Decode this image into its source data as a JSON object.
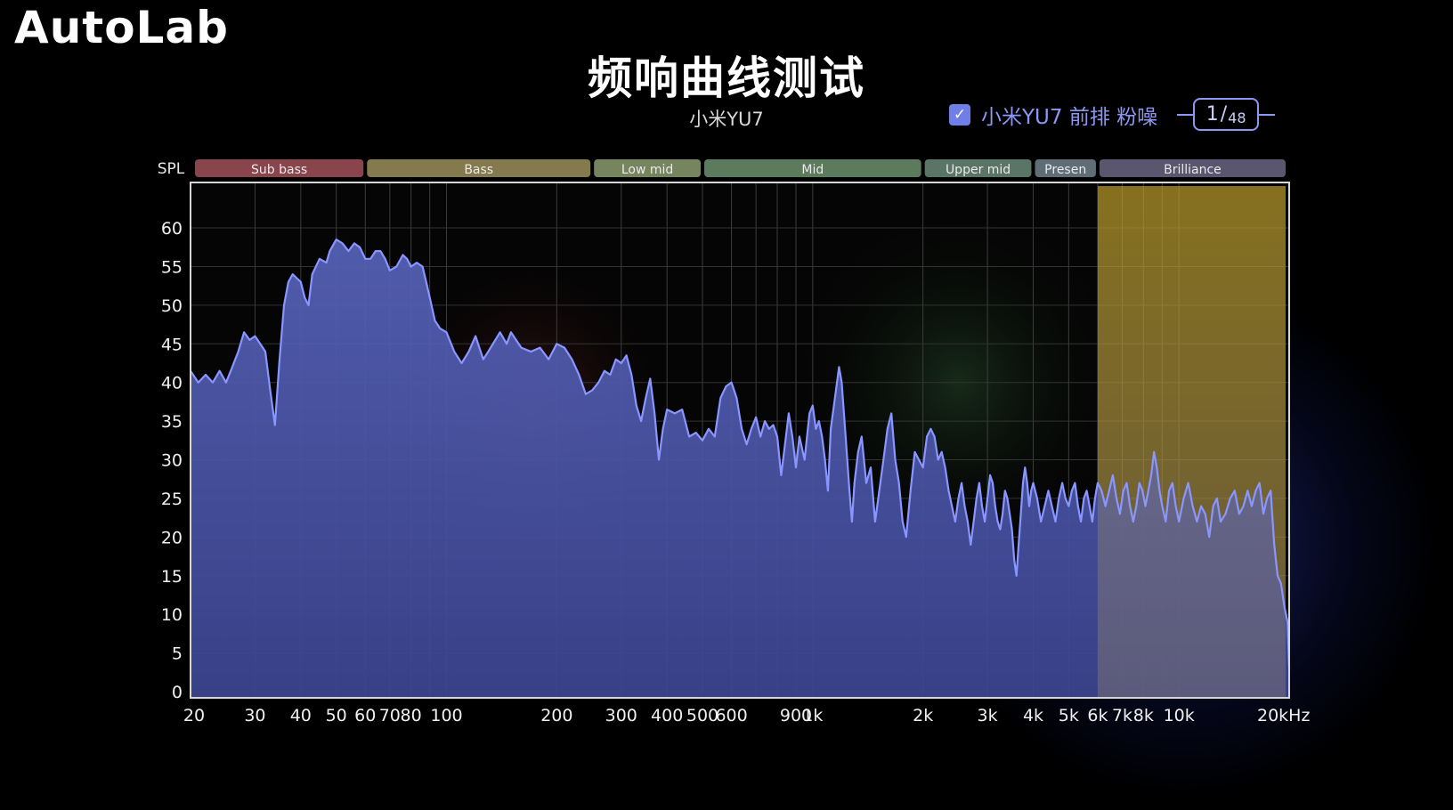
{
  "brand": {
    "logo": "AutoLab"
  },
  "header": {
    "title": "频响曲线测试",
    "subtitle": "小米YU7"
  },
  "legend": {
    "checked": true,
    "label": "小米YU7 前排 粉噪",
    "page_current": "1",
    "page_separator": "/",
    "page_total": "48"
  },
  "colors": {
    "background": "#000000",
    "series_line": "#8a96ff",
    "series_fill": "#4a57a8",
    "accent": "#8b97f2",
    "highlight_band": "#b89a1e"
  },
  "chart_data": {
    "type": "area",
    "title": "频响曲线测试",
    "ylabel": "SPL",
    "xlabel": "",
    "x_scale": "log",
    "x_unit": "Hz",
    "xlim": [
      20,
      20000
    ],
    "ylim": [
      0,
      63
    ],
    "grid": true,
    "y_ticks": [
      "0",
      "5",
      "10",
      "15",
      "20",
      "25",
      "30",
      "35",
      "40",
      "45",
      "50",
      "55",
      "60"
    ],
    "x_ticks": [
      {
        "v": 20,
        "label": "20"
      },
      {
        "v": 30,
        "label": "30"
      },
      {
        "v": 40,
        "label": "40"
      },
      {
        "v": 50,
        "label": "50"
      },
      {
        "v": 60,
        "label": "60"
      },
      {
        "v": 70,
        "label": "70"
      },
      {
        "v": 80,
        "label": "80"
      },
      {
        "v": 100,
        "label": "100"
      },
      {
        "v": 200,
        "label": "200"
      },
      {
        "v": 300,
        "label": "300"
      },
      {
        "v": 400,
        "label": "400"
      },
      {
        "v": 500,
        "label": "500"
      },
      {
        "v": 600,
        "label": "600"
      },
      {
        "v": 900,
        "label": "900"
      },
      {
        "v": 1000,
        "label": "1k"
      },
      {
        "v": 2000,
        "label": "2k"
      },
      {
        "v": 3000,
        "label": "3k"
      },
      {
        "v": 4000,
        "label": "4k"
      },
      {
        "v": 5000,
        "label": "5k"
      },
      {
        "v": 6000,
        "label": "6k"
      },
      {
        "v": 7000,
        "label": "7k"
      },
      {
        "v": 8000,
        "label": "8k"
      },
      {
        "v": 10000,
        "label": "10k"
      },
      {
        "v": 20000,
        "label": "20kHz"
      }
    ],
    "bands": [
      {
        "name": "Sub bass",
        "from": 20,
        "to": 60,
        "color": "#8a454c"
      },
      {
        "name": "Bass",
        "from": 60,
        "to": 250,
        "color": "#857a4e"
      },
      {
        "name": "Low mid",
        "from": 250,
        "to": 500,
        "color": "#77855f"
      },
      {
        "name": "Mid",
        "from": 500,
        "to": 2000,
        "color": "#5c7a5c"
      },
      {
        "name": "Upper mid",
        "from": 2000,
        "to": 4000,
        "color": "#5a7565"
      },
      {
        "name": "Presen",
        "from": 4000,
        "to": 6000,
        "color": "#5f6e76"
      },
      {
        "name": "Brilliance",
        "from": 6000,
        "to": 20000,
        "color": "#5a5670"
      }
    ],
    "highlight": {
      "from": 6000,
      "to": 20000
    },
    "series": [
      {
        "name": "小米YU7 前排 粉噪",
        "points": [
          [
            20,
            41.5
          ],
          [
            21,
            40
          ],
          [
            22,
            41
          ],
          [
            23,
            40
          ],
          [
            24,
            41.5
          ],
          [
            25,
            40
          ],
          [
            26,
            42
          ],
          [
            27,
            44
          ],
          [
            28,
            46.5
          ],
          [
            29,
            45.5
          ],
          [
            30,
            46
          ],
          [
            31,
            45
          ],
          [
            32,
            44
          ],
          [
            33,
            39
          ],
          [
            34,
            34.5
          ],
          [
            35,
            43
          ],
          [
            36,
            50
          ],
          [
            37,
            53
          ],
          [
            38,
            54
          ],
          [
            39,
            53.5
          ],
          [
            40,
            53
          ],
          [
            41,
            51
          ],
          [
            42,
            50
          ],
          [
            43,
            54
          ],
          [
            44,
            55
          ],
          [
            45,
            56
          ],
          [
            47,
            55.5
          ],
          [
            48,
            57
          ],
          [
            50,
            58.5
          ],
          [
            52,
            58
          ],
          [
            54,
            57
          ],
          [
            56,
            58
          ],
          [
            58,
            57.5
          ],
          [
            60,
            56
          ],
          [
            62,
            56
          ],
          [
            64,
            57
          ],
          [
            66,
            57
          ],
          [
            68,
            56
          ],
          [
            70,
            54.5
          ],
          [
            73,
            55
          ],
          [
            76,
            56.5
          ],
          [
            78,
            56
          ],
          [
            80,
            55
          ],
          [
            83,
            55.5
          ],
          [
            86,
            55
          ],
          [
            88,
            53
          ],
          [
            90,
            51
          ],
          [
            93,
            48
          ],
          [
            96,
            47
          ],
          [
            100,
            46.5
          ],
          [
            105,
            44
          ],
          [
            110,
            42.5
          ],
          [
            115,
            44
          ],
          [
            120,
            46
          ],
          [
            126,
            43
          ],
          [
            130,
            44
          ],
          [
            140,
            46.5
          ],
          [
            146,
            45
          ],
          [
            150,
            46.5
          ],
          [
            160,
            44.5
          ],
          [
            170,
            44
          ],
          [
            180,
            44.5
          ],
          [
            190,
            43
          ],
          [
            200,
            45
          ],
          [
            210,
            44.5
          ],
          [
            220,
            43
          ],
          [
            230,
            41
          ],
          [
            240,
            38.5
          ],
          [
            250,
            39
          ],
          [
            260,
            40
          ],
          [
            270,
            41.5
          ],
          [
            280,
            41
          ],
          [
            290,
            43
          ],
          [
            300,
            42.5
          ],
          [
            310,
            43.5
          ],
          [
            320,
            41
          ],
          [
            330,
            37
          ],
          [
            340,
            35
          ],
          [
            350,
            38
          ],
          [
            360,
            40.5
          ],
          [
            370,
            36
          ],
          [
            380,
            30
          ],
          [
            390,
            34
          ],
          [
            400,
            36.5
          ],
          [
            420,
            36
          ],
          [
            440,
            36.5
          ],
          [
            460,
            33
          ],
          [
            480,
            33.5
          ],
          [
            500,
            32.5
          ],
          [
            520,
            34
          ],
          [
            540,
            33
          ],
          [
            560,
            38
          ],
          [
            580,
            39.5
          ],
          [
            600,
            40
          ],
          [
            620,
            38
          ],
          [
            640,
            34
          ],
          [
            660,
            32
          ],
          [
            680,
            34
          ],
          [
            700,
            35.5
          ],
          [
            720,
            33
          ],
          [
            740,
            35
          ],
          [
            760,
            34
          ],
          [
            780,
            34.5
          ],
          [
            800,
            33
          ],
          [
            820,
            28
          ],
          [
            840,
            32
          ],
          [
            860,
            36
          ],
          [
            880,
            33
          ],
          [
            900,
            29
          ],
          [
            920,
            33
          ],
          [
            950,
            30
          ],
          [
            980,
            36
          ],
          [
            1000,
            37
          ],
          [
            1020,
            34
          ],
          [
            1040,
            35
          ],
          [
            1060,
            33
          ],
          [
            1080,
            30
          ],
          [
            1100,
            26
          ],
          [
            1120,
            34
          ],
          [
            1150,
            38
          ],
          [
            1180,
            42
          ],
          [
            1200,
            40
          ],
          [
            1230,
            33
          ],
          [
            1260,
            26
          ],
          [
            1280,
            22
          ],
          [
            1300,
            27
          ],
          [
            1330,
            31
          ],
          [
            1360,
            33
          ],
          [
            1400,
            27
          ],
          [
            1440,
            29
          ],
          [
            1480,
            22
          ],
          [
            1520,
            26
          ],
          [
            1560,
            30
          ],
          [
            1600,
            34
          ],
          [
            1640,
            36
          ],
          [
            1680,
            30
          ],
          [
            1720,
            27
          ],
          [
            1760,
            22
          ],
          [
            1800,
            20
          ],
          [
            1850,
            26
          ],
          [
            1900,
            31
          ],
          [
            1950,
            30
          ],
          [
            2000,
            29
          ],
          [
            2050,
            33
          ],
          [
            2100,
            34
          ],
          [
            2150,
            33
          ],
          [
            2200,
            30
          ],
          [
            2250,
            31
          ],
          [
            2300,
            29
          ],
          [
            2350,
            26
          ],
          [
            2400,
            24
          ],
          [
            2450,
            22
          ],
          [
            2500,
            25
          ],
          [
            2550,
            27
          ],
          [
            2600,
            24
          ],
          [
            2650,
            22
          ],
          [
            2700,
            19
          ],
          [
            2750,
            22
          ],
          [
            2800,
            25
          ],
          [
            2850,
            27
          ],
          [
            2900,
            24
          ],
          [
            2950,
            22
          ],
          [
            3000,
            25
          ],
          [
            3050,
            28
          ],
          [
            3100,
            27
          ],
          [
            3150,
            24
          ],
          [
            3200,
            22
          ],
          [
            3250,
            21
          ],
          [
            3300,
            23
          ],
          [
            3350,
            26
          ],
          [
            3400,
            25
          ],
          [
            3450,
            23
          ],
          [
            3500,
            21
          ],
          [
            3550,
            17
          ],
          [
            3600,
            15
          ],
          [
            3650,
            19
          ],
          [
            3700,
            23
          ],
          [
            3750,
            27
          ],
          [
            3800,
            29
          ],
          [
            3850,
            27
          ],
          [
            3900,
            24
          ],
          [
            3950,
            26
          ],
          [
            4000,
            27
          ],
          [
            4100,
            25
          ],
          [
            4200,
            22
          ],
          [
            4300,
            24
          ],
          [
            4400,
            26
          ],
          [
            4500,
            24
          ],
          [
            4600,
            22
          ],
          [
            4700,
            25
          ],
          [
            4800,
            27
          ],
          [
            4900,
            25
          ],
          [
            5000,
            24
          ],
          [
            5100,
            26
          ],
          [
            5200,
            27
          ],
          [
            5300,
            24
          ],
          [
            5400,
            22
          ],
          [
            5500,
            25
          ],
          [
            5600,
            26
          ],
          [
            5700,
            24
          ],
          [
            5800,
            22
          ],
          [
            5900,
            25
          ],
          [
            6000,
            27
          ],
          [
            6150,
            26
          ],
          [
            6300,
            24
          ],
          [
            6450,
            26
          ],
          [
            6600,
            28
          ],
          [
            6750,
            25
          ],
          [
            6900,
            23
          ],
          [
            7050,
            26
          ],
          [
            7200,
            27
          ],
          [
            7350,
            24
          ],
          [
            7500,
            22
          ],
          [
            7650,
            24
          ],
          [
            7800,
            27
          ],
          [
            7950,
            26
          ],
          [
            8100,
            24
          ],
          [
            8250,
            26
          ],
          [
            8400,
            28
          ],
          [
            8550,
            31
          ],
          [
            8700,
            29
          ],
          [
            8850,
            26
          ],
          [
            9000,
            24
          ],
          [
            9200,
            22
          ],
          [
            9400,
            26
          ],
          [
            9600,
            27
          ],
          [
            9800,
            24
          ],
          [
            10000,
            22
          ],
          [
            10300,
            25
          ],
          [
            10600,
            27
          ],
          [
            10900,
            24
          ],
          [
            11200,
            22
          ],
          [
            11500,
            24
          ],
          [
            11800,
            23
          ],
          [
            12100,
            20
          ],
          [
            12400,
            24
          ],
          [
            12700,
            25
          ],
          [
            13000,
            22
          ],
          [
            13400,
            23
          ],
          [
            13800,
            25
          ],
          [
            14200,
            26
          ],
          [
            14600,
            23
          ],
          [
            15000,
            24
          ],
          [
            15400,
            26
          ],
          [
            15800,
            24
          ],
          [
            16200,
            26
          ],
          [
            16600,
            27
          ],
          [
            17000,
            23
          ],
          [
            17400,
            25
          ],
          [
            17800,
            26
          ],
          [
            18200,
            19
          ],
          [
            18600,
            15
          ],
          [
            19000,
            14
          ],
          [
            19400,
            11
          ],
          [
            19800,
            9
          ],
          [
            20000,
            3
          ]
        ]
      }
    ]
  }
}
